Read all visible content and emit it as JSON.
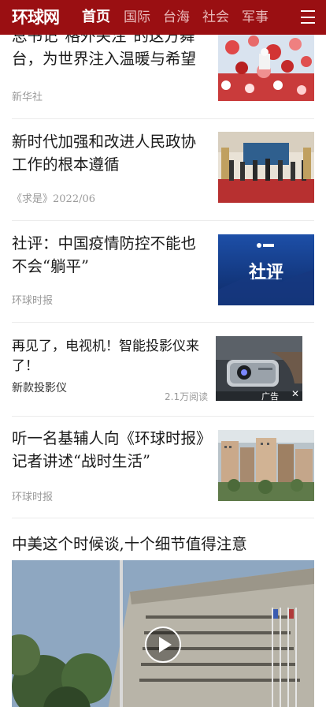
{
  "header": {
    "logo": "环球网",
    "nav": [
      "首页",
      "国际",
      "台海",
      "社会",
      "军事"
    ],
    "menu_icon": "hamburger-menu-icon"
  },
  "feed": {
    "items": [
      {
        "title": "总书记“格外关注”的这方舞台，为世界注入温暖与希望",
        "title_visible": "总书记\"格外关注\"的这方舞台，为世界注入温暖与希望",
        "source": "新华社"
      },
      {
        "title": "新时代加强和改进人民政协工作的根本遵循",
        "source": "《求是》2022/06"
      },
      {
        "title": "社评：中国疫情防控不能也不会“躺平”",
        "source": "环球时报",
        "thumb_text": "社评"
      },
      {
        "title": "听一名基辅人向《环球时报》记者讲述“战时生活”",
        "source": "环球时报"
      }
    ],
    "ad": {
      "title": "再见了，电视机！智能投影仪来了！",
      "subtitle": "新款投影仪",
      "reads": "2.1万阅读",
      "badge": "广告"
    },
    "video": {
      "title": "中美这个时候谈,十个细节值得注意",
      "icon": "play-icon"
    }
  },
  "colors": {
    "header": "#9a0f12",
    "nav_active": "#ffffff",
    "nav_inactive": "#e8b9b9",
    "source": "#9a9a9a"
  }
}
